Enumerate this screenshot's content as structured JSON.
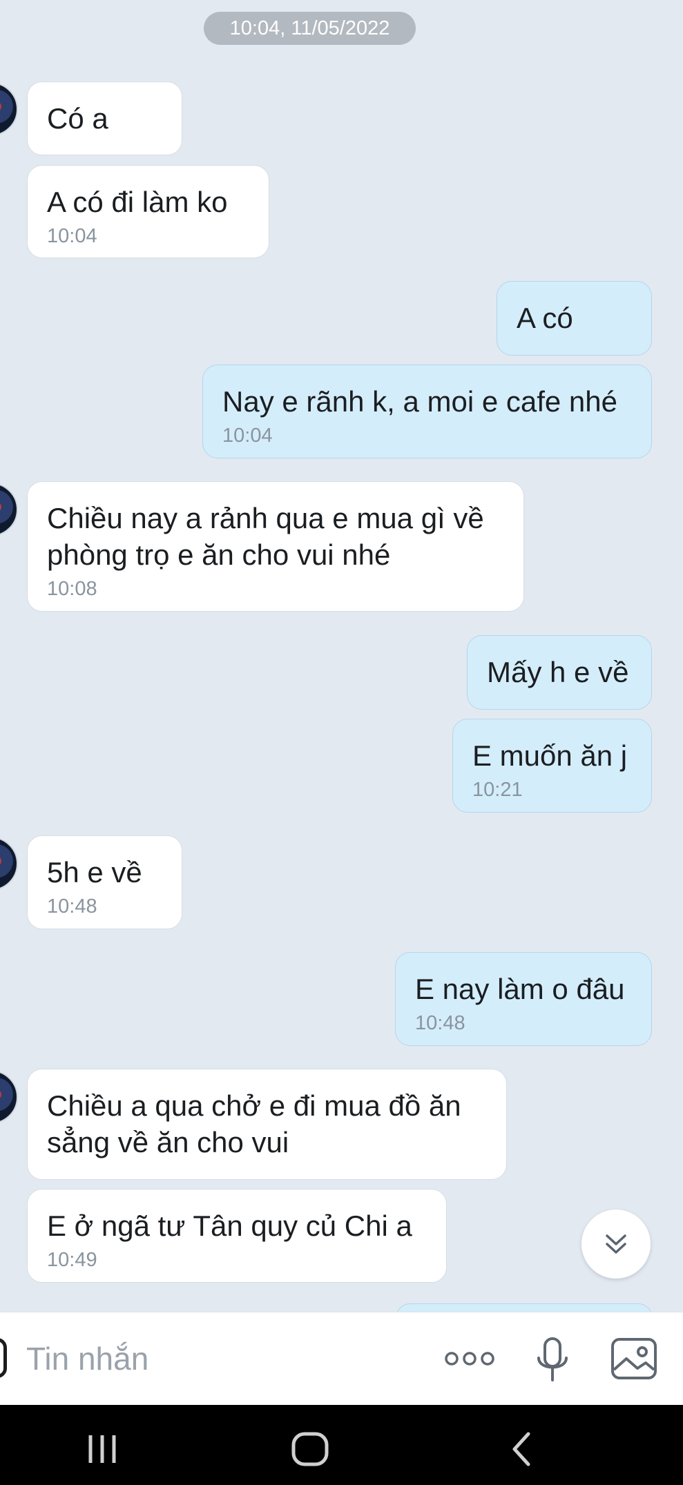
{
  "chat": {
    "date_chip": "10:04, 11/05/2022",
    "messages": [
      {
        "side": "in",
        "text": "Có a",
        "time": ""
      },
      {
        "side": "in",
        "text": "A có đi làm ko",
        "time": "10:04"
      },
      {
        "side": "out",
        "text": "A có",
        "time": ""
      },
      {
        "side": "out",
        "text": "Nay e rãnh k, a moi e cafe nhé",
        "time": "10:04"
      },
      {
        "side": "in",
        "line1": "Chiều nay a rảnh qua e mua gì về",
        "line2": "phòng trọ e ăn cho vui nhé",
        "time": "10:08"
      },
      {
        "side": "out",
        "text": "Mấy h e về",
        "time": ""
      },
      {
        "side": "out",
        "text": "E muốn ăn j",
        "time": "10:21"
      },
      {
        "side": "in",
        "text": "5h e về",
        "time": "10:48"
      },
      {
        "side": "out",
        "text": "E nay làm o đâu",
        "time": "10:48"
      },
      {
        "side": "in",
        "line1": "Chiều a qua chở e đi mua đồ ăn",
        "line2": "sẳng về ăn cho vui",
        "time": ""
      },
      {
        "side": "in",
        "text": "E ở ngã tư Tân quy củ Chi a",
        "time": "10:49"
      }
    ]
  },
  "composer": {
    "placeholder": "Tin nhắn",
    "more_icon": "more-dots-icon",
    "mic_icon": "microphone-icon",
    "image_icon": "image-icon"
  },
  "colors": {
    "background": "#e2e9f1",
    "incoming_bubble": "#ffffff",
    "outgoing_bubble": "#d4edfb",
    "timestamp": "#8a949e"
  }
}
